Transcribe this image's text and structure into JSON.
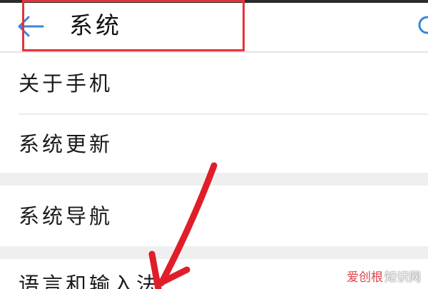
{
  "header": {
    "title": "系统",
    "back_icon": "back-arrow-icon",
    "search_icon": "search-icon",
    "accent_color": "#3a86d8"
  },
  "annotation": {
    "box_color": "#e5323a",
    "arrow_color": "#e01e2a"
  },
  "settings_items": [
    {
      "label": "关于手机"
    },
    {
      "label": "系统更新"
    },
    {
      "label": "系统导航"
    },
    {
      "label": "语言和输入法"
    }
  ],
  "watermark": {
    "brand": "爱创根",
    "suffix": "知识网"
  }
}
